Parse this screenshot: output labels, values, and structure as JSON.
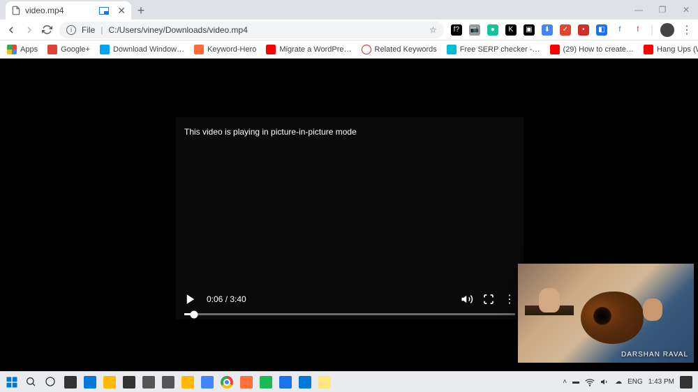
{
  "tab": {
    "title": "video.mp4"
  },
  "address": {
    "scheme": "File",
    "path": "C:/Users/viney/Downloads/video.mp4"
  },
  "window_controls": {
    "min": "—",
    "max": "❐",
    "close": "✕"
  },
  "ext_icons": [
    {
      "name": "f-question",
      "bg": "#000",
      "label": "f?"
    },
    {
      "name": "camera",
      "bg": "#999",
      "label": "📷"
    },
    {
      "name": "grammarly",
      "bg": "#15c39a",
      "label": "●"
    },
    {
      "name": "k-circle",
      "bg": "#000",
      "label": "K"
    },
    {
      "name": "pip-ext",
      "bg": "#000",
      "label": "▣"
    },
    {
      "name": "download",
      "bg": "#4285f4",
      "label": "⬇"
    },
    {
      "name": "todoist",
      "bg": "#e44332",
      "label": "✓"
    },
    {
      "name": "lastpass",
      "bg": "#d32d27",
      "label": "•"
    },
    {
      "name": "colorzilla",
      "bg": "#1a73e8",
      "label": "◧"
    },
    {
      "name": "facebook",
      "bg": "#fff",
      "label": "f"
    },
    {
      "name": "f-red",
      "bg": "#fff",
      "label": "f"
    }
  ],
  "bookmarks": [
    {
      "name": "apps",
      "label": "Apps",
      "color": "#5f6368"
    },
    {
      "name": "google-plus",
      "label": "Google+",
      "color": "#db4437"
    },
    {
      "name": "download-windows",
      "label": "Download Window…",
      "color": "#00a4ef"
    },
    {
      "name": "keyword-hero",
      "label": "Keyword-Hero",
      "color": "#ff6b35"
    },
    {
      "name": "migrate-wp",
      "label": "Migrate a WordPre…",
      "color": "#ff0000"
    },
    {
      "name": "related-keywords",
      "label": "Related Keywords",
      "color": "#fff"
    },
    {
      "name": "serp-checker",
      "label": "Free SERP checker -…",
      "color": "#00bcd4"
    },
    {
      "name": "how-to-create",
      "label": "(29) How to create…",
      "color": "#ff0000"
    },
    {
      "name": "hang-ups",
      "label": "Hang Ups (Want Yo…",
      "color": "#ff0000"
    }
  ],
  "video": {
    "pip_message": "This video is playing in picture-in-picture mode",
    "current_time": "0:06",
    "duration": "3:40",
    "progress_pct": 3
  },
  "pip": {
    "caption": "DARSHAN RAVAL"
  },
  "taskbar": [
    {
      "name": "start",
      "color": "#0078d7"
    },
    {
      "name": "search",
      "color": "#333"
    },
    {
      "name": "cortana",
      "color": "#333"
    },
    {
      "name": "task-view",
      "color": "#333"
    },
    {
      "name": "edge",
      "color": "#0078d7"
    },
    {
      "name": "explorer",
      "color": "#ffb900"
    },
    {
      "name": "store",
      "color": "#333"
    },
    {
      "name": "mail",
      "color": "#555"
    },
    {
      "name": "settings",
      "color": "#555"
    },
    {
      "name": "sticky",
      "color": "#ffb900"
    },
    {
      "name": "ads",
      "color": "#4285f4"
    },
    {
      "name": "chrome",
      "color": "#fff"
    },
    {
      "name": "firefox",
      "color": "#ff7139"
    },
    {
      "name": "spotify",
      "color": "#1db954"
    },
    {
      "name": "app-blue",
      "color": "#1a73e8"
    },
    {
      "name": "edge2",
      "color": "#0078d7"
    },
    {
      "name": "notepad",
      "color": "#ffe97f"
    }
  ],
  "tray": {
    "lang": "ENG",
    "time": "1:43 PM"
  }
}
